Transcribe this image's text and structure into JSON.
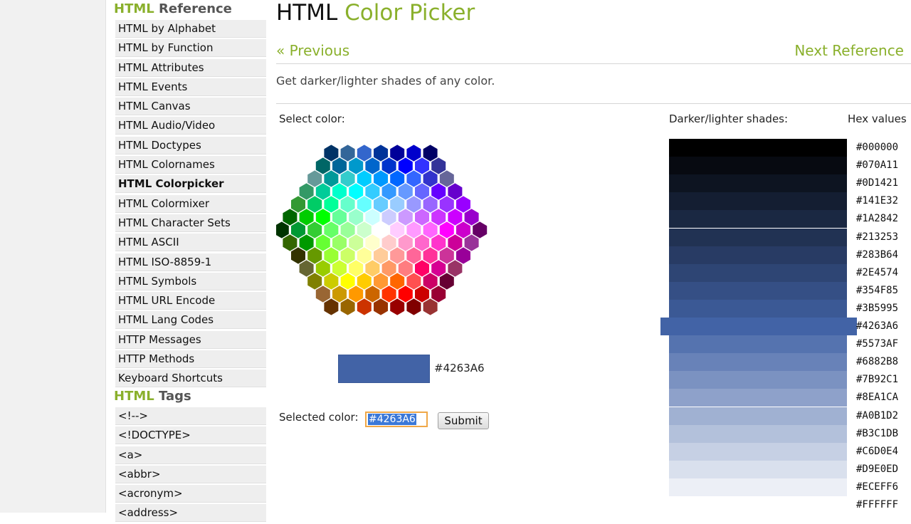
{
  "sidebar": {
    "reference_heading_accent": "HTML",
    "reference_heading_rest": " Reference",
    "reference_items": [
      {
        "label": "HTML by Alphabet",
        "active": false
      },
      {
        "label": "HTML by Function",
        "active": false
      },
      {
        "label": "HTML Attributes",
        "active": false
      },
      {
        "label": "HTML Events",
        "active": false
      },
      {
        "label": "HTML Canvas",
        "active": false
      },
      {
        "label": "HTML Audio/Video",
        "active": false
      },
      {
        "label": "HTML Doctypes",
        "active": false
      },
      {
        "label": "HTML Colornames",
        "active": false
      },
      {
        "label": "HTML Colorpicker",
        "active": true
      },
      {
        "label": "HTML Colormixer",
        "active": false
      },
      {
        "label": "HTML Character Sets",
        "active": false
      },
      {
        "label": "HTML ASCII",
        "active": false
      },
      {
        "label": "HTML ISO-8859-1",
        "active": false
      },
      {
        "label": "HTML Symbols",
        "active": false
      },
      {
        "label": "HTML URL Encode",
        "active": false
      },
      {
        "label": "HTML Lang Codes",
        "active": false
      },
      {
        "label": "HTTP Messages",
        "active": false
      },
      {
        "label": "HTTP Methods",
        "active": false
      },
      {
        "label": "Keyboard Shortcuts",
        "active": false
      }
    ],
    "tags_heading_accent": "HTML",
    "tags_heading_rest": " Tags",
    "tag_items": [
      "<!-->",
      "<!DOCTYPE>",
      "<a>",
      "<abbr>",
      "<acronym>",
      "<address>"
    ]
  },
  "header": {
    "title_plain": "HTML ",
    "title_accent": "Color Picker",
    "prev_link": "« Previous",
    "next_link": "Next Reference"
  },
  "intro": "Get darker/lighter shades of any color.",
  "picker": {
    "select_label": "Select color:",
    "preview_color": "#4263A6",
    "preview_hex": "#4263A6",
    "selected_label": "Selected color:",
    "selected_value": "#4263A6",
    "submit_label": "Submit"
  },
  "shades": {
    "label": "Darker/lighter shades:",
    "hex_label": "Hex values",
    "selected_index": 10,
    "values": [
      "#000000",
      "#070A11",
      "#0D1421",
      "#141E32",
      "#1A2842",
      "#213253",
      "#283B64",
      "#2E4574",
      "#354F85",
      "#3B5995",
      "#4263A6",
      "#5573AF",
      "#6882B8",
      "#7B92C1",
      "#8EA1CA",
      "#A0B1D2",
      "#B3C1DB",
      "#C6D0E4",
      "#D9E0ED",
      "#ECEFF6",
      "#FFFFFF"
    ]
  },
  "hexmap": {
    "rows": [
      [
        "#003366",
        "#336699",
        "#3366CC",
        "#003399",
        "#000099",
        "#0000CC",
        "#000066"
      ],
      [
        "#006666",
        "#006699",
        "#0099CC",
        "#0066CC",
        "#0033CC",
        "#0000FF",
        "#3333FF",
        "#333399"
      ],
      [
        "#669999",
        "#009999",
        "#33CCCC",
        "#00CCFF",
        "#0099FF",
        "#0066FF",
        "#3366FF",
        "#3333CC",
        "#666699"
      ],
      [
        "#339966",
        "#00CC99",
        "#00FFCC",
        "#00FFFF",
        "#33CCFF",
        "#3399FF",
        "#6699FF",
        "#6666FF",
        "#6600FF",
        "#6600CC"
      ],
      [
        "#339933",
        "#00CC66",
        "#00FF99",
        "#66FFCC",
        "#66FFFF",
        "#66CCFF",
        "#99CCFF",
        "#9999FF",
        "#9966FF",
        "#9933FF",
        "#9900FF"
      ],
      [
        "#006600",
        "#00CC00",
        "#00FF00",
        "#66FF99",
        "#99FFCC",
        "#CCFFFF",
        "#CCCCFF",
        "#CC99FF",
        "#CC66FF",
        "#CC33FF",
        "#CC00FF",
        "#9900CC"
      ],
      [
        "#003300",
        "#009933",
        "#33CC33",
        "#66FF66",
        "#99FF99",
        "#CCFFCC",
        "#FFFFFF",
        "#FFCCFF",
        "#FF99FF",
        "#FF66FF",
        "#FF00FF",
        "#CC00CC",
        "#660066"
      ],
      [
        "#336600",
        "#009900",
        "#66FF33",
        "#99FF66",
        "#CCFF99",
        "#FFFFCC",
        "#FFCCCC",
        "#FF99CC",
        "#FF66CC",
        "#FF33CC",
        "#CC0099",
        "#993399"
      ],
      [
        "#333300",
        "#669900",
        "#99FF33",
        "#CCFF66",
        "#FFFF99",
        "#FFCC99",
        "#FF9999",
        "#FF6699",
        "#FF3399",
        "#CC3399",
        "#990099"
      ],
      [
        "#666633",
        "#99CC00",
        "#CCFF33",
        "#FFFF66",
        "#FFCC66",
        "#FF9966",
        "#FF7C80",
        "#FF0066",
        "#D60093",
        "#993366"
      ],
      [
        "#808000",
        "#CCCC00",
        "#FFFF00",
        "#FFCC00",
        "#FF9933",
        "#FF6600",
        "#FF5050",
        "#CC0066",
        "#660033"
      ],
      [
        "#996633",
        "#CC9900",
        "#FF9900",
        "#CC6600",
        "#FF3300",
        "#FF0000",
        "#CC0000",
        "#990033"
      ],
      [
        "#663300",
        "#996600",
        "#CC3300",
        "#993300",
        "#990000",
        "#800000",
        "#993333"
      ]
    ]
  }
}
